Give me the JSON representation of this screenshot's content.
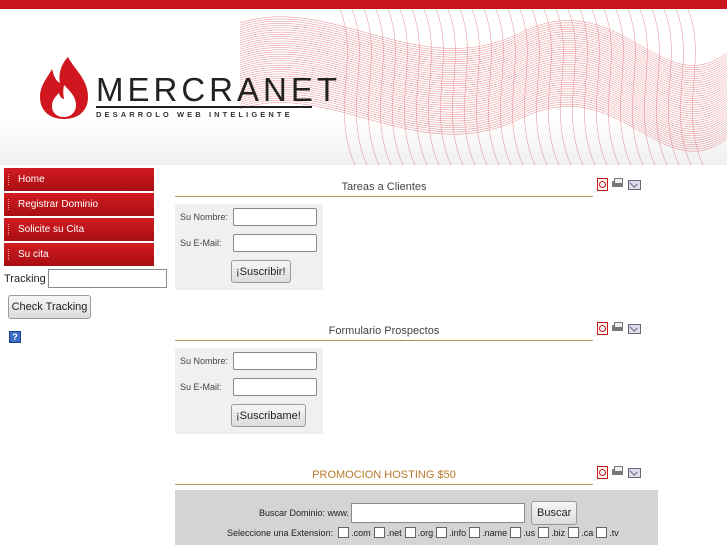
{
  "brand": {
    "name": "MERCRANET",
    "tagline": "DESARROLO WEB INTELIGENTE",
    "accent": "#c8141c"
  },
  "sidebar": {
    "items": [
      {
        "label": "Home"
      },
      {
        "label": "Registrar Dominio"
      },
      {
        "label": "Solicite su Cita"
      },
      {
        "label": "Su cita"
      }
    ],
    "tracking_label": "Tracking",
    "tracking_value": "",
    "check_button": "Check Tracking",
    "help_icon": "?"
  },
  "sections": [
    {
      "title": "Tareas a Clientes",
      "name_label": "Su Nombre:",
      "email_label": "Su E-Mail:",
      "button": "¡Suscribir!"
    },
    {
      "title": "Formulario Prospectos",
      "name_label": "Su Nombre:",
      "email_label": "Su E-Mail:",
      "button": "¡Suscribame!"
    }
  ],
  "promo": {
    "title": "PROMOCION HOSTING $50",
    "search_label": "Buscar Dominio: www.",
    "search_value": "",
    "search_button": "Buscar",
    "extension_label": "Seleccione una Extension:",
    "extensions": [
      ".com",
      ".net",
      ".org",
      ".info",
      ".name",
      ".us",
      ".biz",
      ".ca",
      ".tv"
    ]
  },
  "icons": [
    "pdf-icon",
    "print-icon",
    "email-icon"
  ]
}
